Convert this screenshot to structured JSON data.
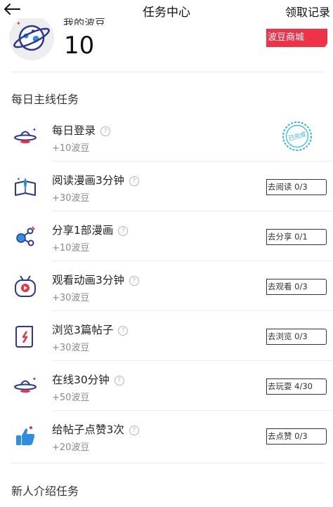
{
  "header": {
    "title": "任务中心",
    "right_link": "领取记录"
  },
  "summary": {
    "balance_label": "我的波豆",
    "balance_value": "10",
    "mall_button": "波豆商城"
  },
  "daily": {
    "title": "每日主线任务",
    "completed_stamp": "已完成",
    "tasks": [
      {
        "name": "每日登录",
        "reward": "+10波豆",
        "icon": "ufo-icon",
        "status": "completed"
      },
      {
        "name": "阅读漫画3分钟",
        "reward": "+30波豆",
        "icon": "book-icon",
        "button": "去阅读 0/3"
      },
      {
        "name": "分享1部漫画",
        "reward": "+10波豆",
        "icon": "share-icon",
        "button": "去分享 0/1"
      },
      {
        "name": "观看动画3分钟",
        "reward": "+30波豆",
        "icon": "tv-icon",
        "button": "去观看 0/3"
      },
      {
        "name": "浏览3篇帖子",
        "reward": "+30波豆",
        "icon": "scroll-icon",
        "button": "去浏览 0/3"
      },
      {
        "name": "在线30分钟",
        "reward": "+50波豆",
        "icon": "ufo-icon",
        "button": "去玩耍 4/30"
      },
      {
        "name": "给帖子点赞3次",
        "reward": "+20波豆",
        "icon": "thumbs-up-icon",
        "button": "去点赞 0/3"
      }
    ]
  },
  "newbie": {
    "title": "新人介绍任务"
  },
  "colors": {
    "accent_red": "#f03249",
    "stamp_blue": "#2bb8e0",
    "icon_red": "#e8334a",
    "icon_blue": "#2d8fe0"
  }
}
